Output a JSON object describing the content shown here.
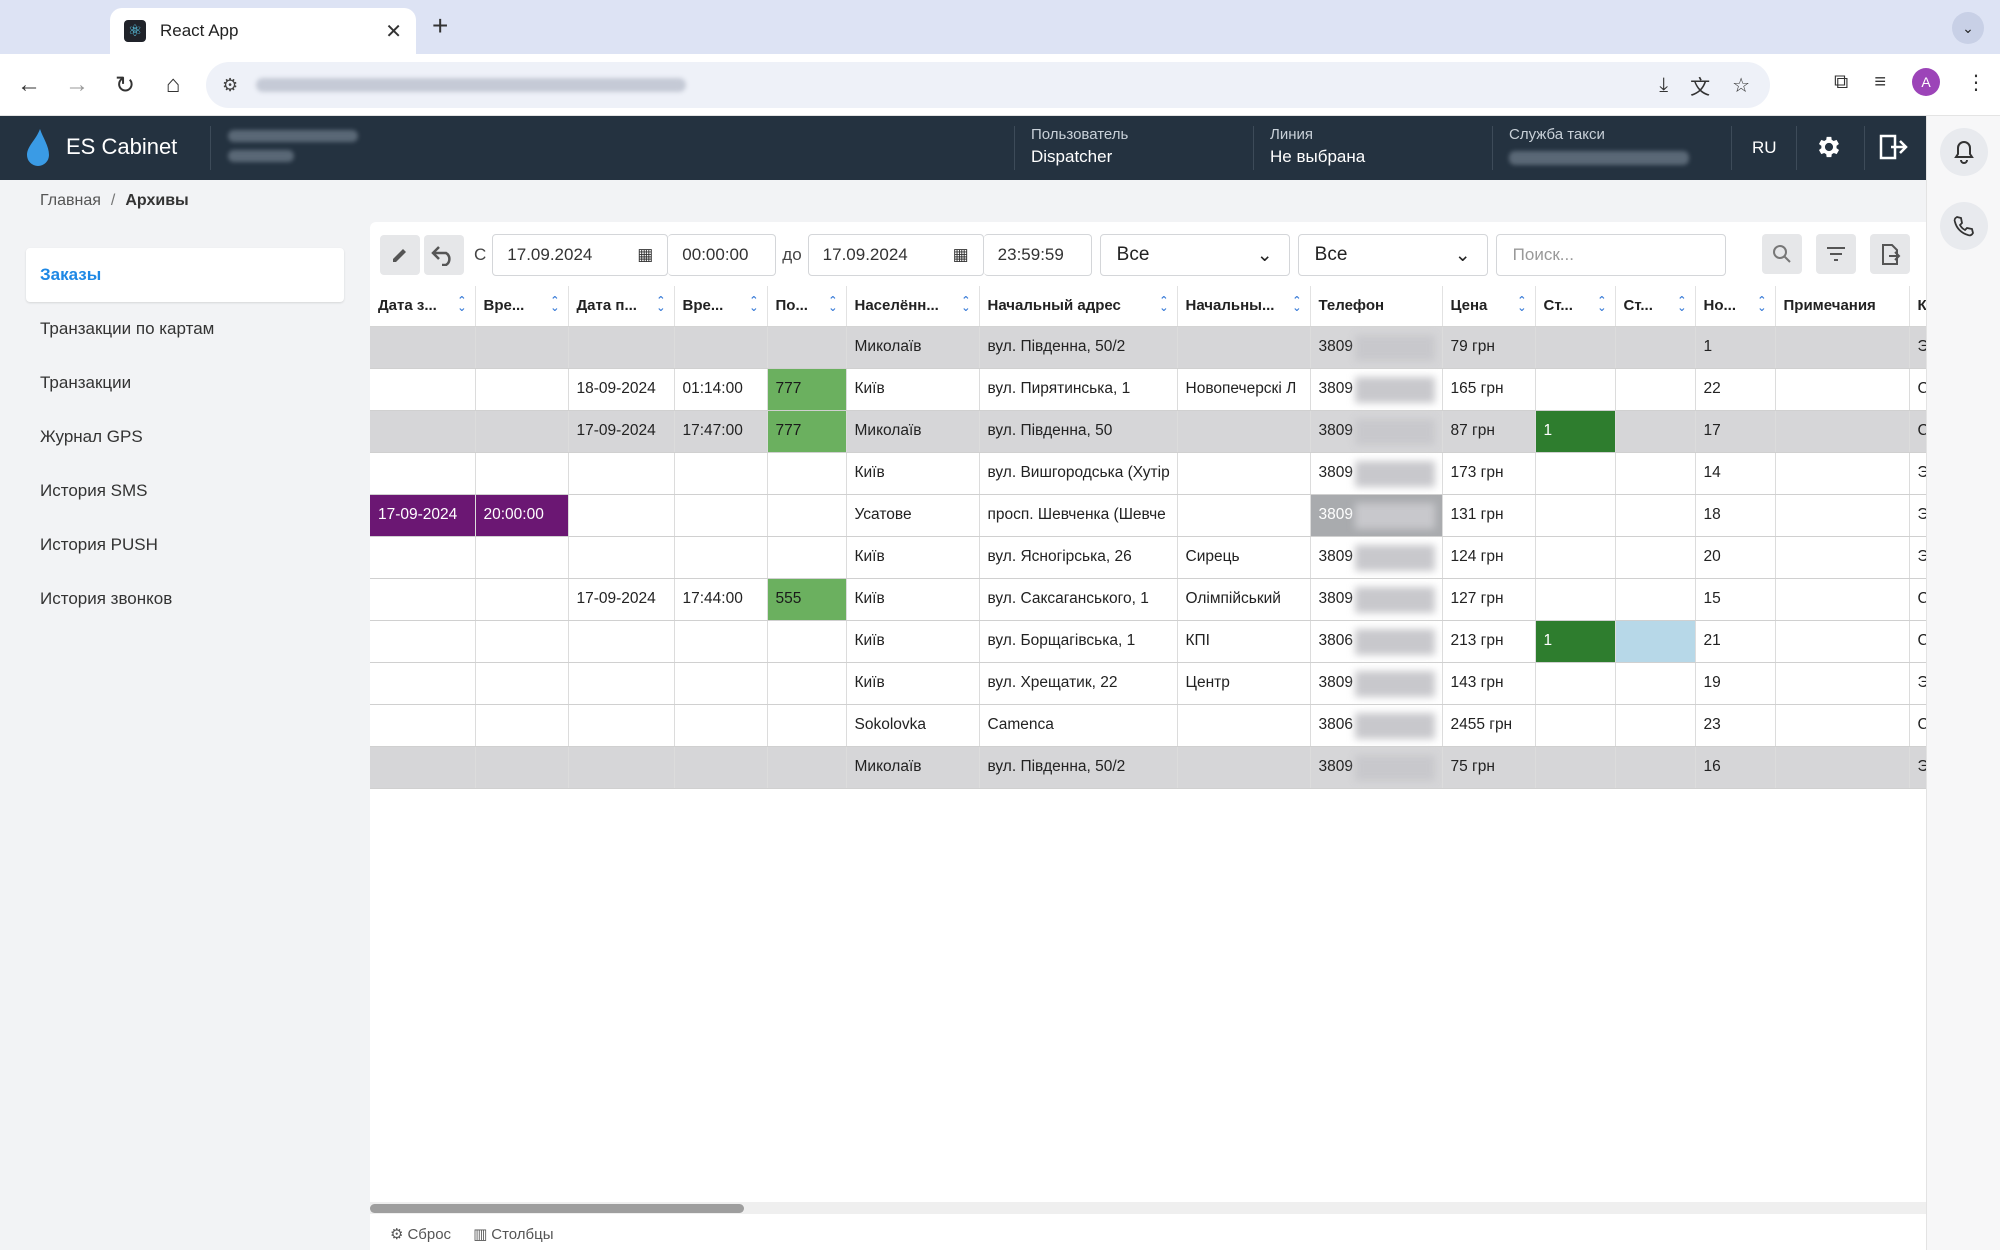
{
  "browser": {
    "tab_title": "React App",
    "tab_close": "✕",
    "new_tab": "+",
    "avatar_letter": "A"
  },
  "header": {
    "logo_text": "ES Cabinet",
    "user_label": "Пользователь",
    "user_value": "Dispatcher",
    "line_label": "Линия",
    "line_value": "Не выбрана",
    "taxi_label": "Служба такси",
    "lang": "RU"
  },
  "breadcrumb": {
    "home": "Главная",
    "sep": "/",
    "current": "Архивы"
  },
  "sidebar": {
    "items": [
      {
        "label": "Заказы"
      },
      {
        "label": "Транзакции по картам"
      },
      {
        "label": "Транзакции"
      },
      {
        "label": "Журнал GPS"
      },
      {
        "label": "История SMS"
      },
      {
        "label": "История PUSH"
      },
      {
        "label": "История звонков"
      }
    ]
  },
  "toolbar": {
    "from_label": "С",
    "from_date": "17.09.2024",
    "from_time": "00:00:00",
    "to_label": "до",
    "to_date": "17.09.2024",
    "to_time": "23:59:59",
    "select1": "Все",
    "select2": "Все",
    "search_placeholder": "Поиск..."
  },
  "table": {
    "columns": [
      "Дата з...",
      "Вре...",
      "Дата п...",
      "Вре...",
      "По...",
      "Населённ...",
      "Начальный адрес",
      "Начальны...",
      "Телефон",
      "Цена",
      "Ст...",
      "Ст...",
      "Но...",
      "Примечания",
      "Кл"
    ],
    "rows": [
      {
        "grey": true,
        "cells": [
          "",
          "",
          "",
          "",
          "",
          "Миколаїв",
          "вул. Південна, 50/2",
          "",
          "3809",
          "79 грн",
          "",
          "",
          "1",
          "",
          "Эк"
        ],
        "colors": {}
      },
      {
        "grey": false,
        "cells": [
          "",
          "",
          "18-09-2024",
          "01:14:00",
          "777",
          "Київ",
          "вул. Пирятинська, 1",
          "Новопечерскі Л",
          "3809",
          "165 грн",
          "",
          "",
          "22",
          "",
          "Ст"
        ],
        "colors": {
          "4": "c-green"
        }
      },
      {
        "grey": true,
        "cells": [
          "",
          "",
          "17-09-2024",
          "17:47:00",
          "777",
          "Миколаїв",
          "вул. Південна, 50",
          "",
          "3809",
          "87 грн",
          "1",
          "",
          "17",
          "",
          "Ст"
        ],
        "colors": {
          "4": "c-green",
          "10": "c-dark"
        }
      },
      {
        "grey": false,
        "cells": [
          "",
          "",
          "",
          "",
          "",
          "Київ",
          "вул. Вишгородська (Хутір",
          "",
          "3809",
          "173 грн",
          "",
          "",
          "14",
          "",
          "Эк"
        ],
        "colors": {}
      },
      {
        "grey": false,
        "cells": [
          "17-09-2024",
          "20:00:00",
          "",
          "",
          "",
          "Усатове",
          "просп. Шевченка (Шевче",
          "",
          "3809",
          "131 грн",
          "",
          "",
          "18",
          "",
          "Эк"
        ],
        "colors": {
          "0": "c-purple",
          "1": "c-purple",
          "8": "c-gray"
        }
      },
      {
        "grey": false,
        "cells": [
          "",
          "",
          "",
          "",
          "",
          "Київ",
          "вул. Ясногірська, 26",
          "Сирець",
          "3809",
          "124 грн",
          "",
          "",
          "20",
          "",
          "Эк"
        ],
        "colors": {}
      },
      {
        "grey": false,
        "cells": [
          "",
          "",
          "17-09-2024",
          "17:44:00",
          "555",
          "Київ",
          "вул. Саксаганського, 1",
          "Олімпійський",
          "3809",
          "127 грн",
          "",
          "",
          "15",
          "",
          "Ст"
        ],
        "colors": {
          "4": "c-green"
        }
      },
      {
        "grey": false,
        "cells": [
          "",
          "",
          "",
          "",
          "",
          "Київ",
          "вул. Борщагівська, 1",
          "КПІ",
          "3806",
          "213 грн",
          "1",
          "",
          "21",
          "",
          "Ст"
        ],
        "colors": {
          "10": "c-dark",
          "11": "c-blue"
        }
      },
      {
        "grey": false,
        "cells": [
          "",
          "",
          "",
          "",
          "",
          "Київ",
          "вул. Хрещатик, 22",
          "Центр",
          "3809",
          "143 грн",
          "",
          "",
          "19",
          "",
          "Эк"
        ],
        "colors": {}
      },
      {
        "grey": false,
        "cells": [
          "",
          "",
          "",
          "",
          "",
          "Sokolovka",
          "Camenca",
          "",
          "3806",
          "2455 грн",
          "",
          "",
          "23",
          "",
          "Ст"
        ],
        "colors": {}
      },
      {
        "grey": true,
        "cells": [
          "",
          "",
          "",
          "",
          "",
          "Миколаїв",
          "вул. Південна, 50/2",
          "",
          "3809",
          "75 грн",
          "",
          "",
          "16",
          "",
          "Эк"
        ],
        "colors": {}
      }
    ]
  },
  "footer": {
    "reset": "Сброс",
    "columns": "Столбцы"
  },
  "colors": {
    "header_bg": "#243240",
    "accent": "#1e88e5",
    "purple": "#6b1773",
    "green": "#6bb05f",
    "dark_green": "#2e7d2e",
    "light_blue": "#b7d8e8"
  }
}
